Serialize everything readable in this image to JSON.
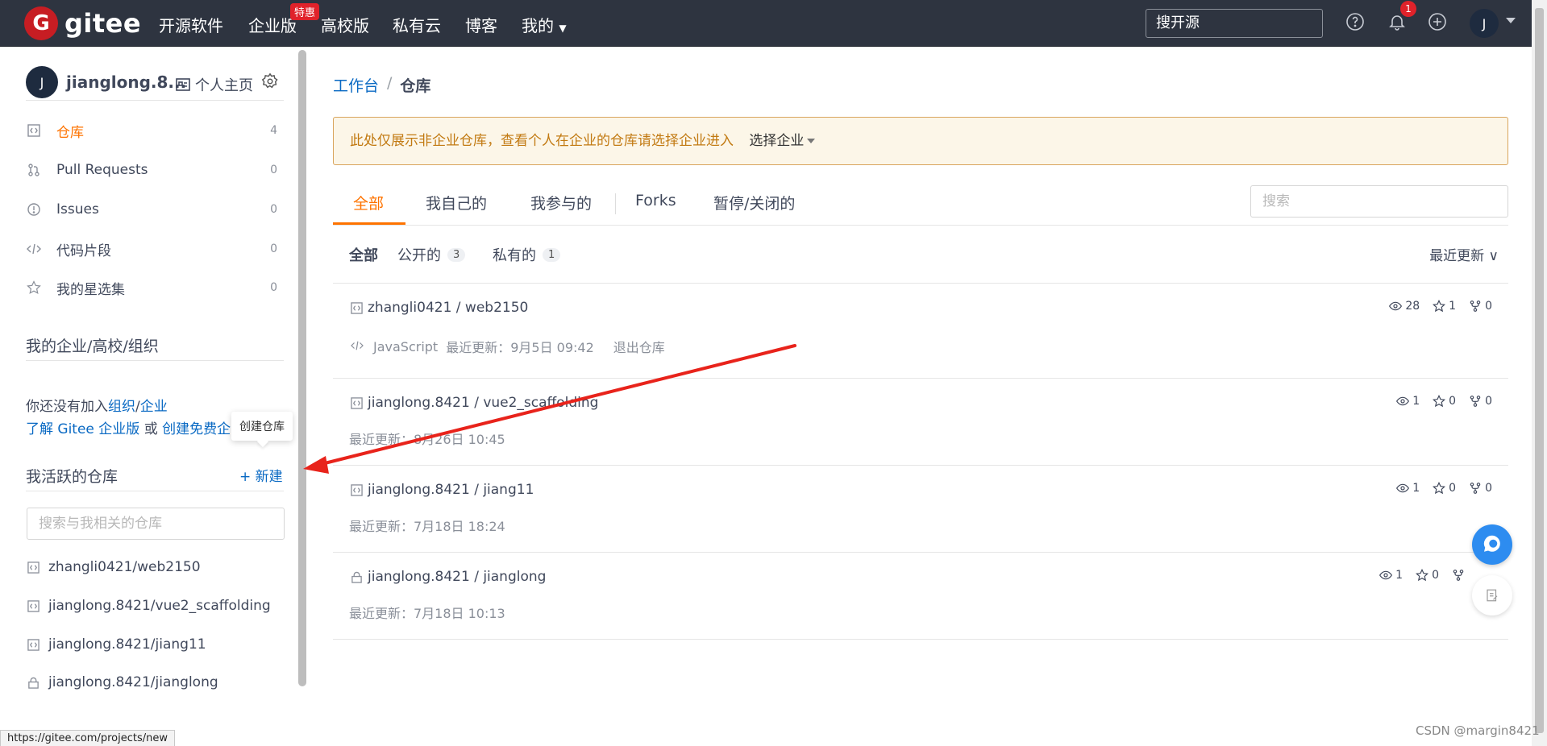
{
  "nav": {
    "logo_letter": "G",
    "logo_text": "gitee",
    "items": [
      "开源软件",
      "企业版",
      "高校版",
      "私有云",
      "博客",
      "我的"
    ],
    "promo_badge": "特惠",
    "search_placeholder": "搜开源",
    "notification_count": "1",
    "avatar_letter": "J"
  },
  "sidebar": {
    "avatar_letter": "J",
    "username": "jianglong.8...",
    "home_label": "个人主页",
    "menu": [
      {
        "label": "仓库",
        "count": "4"
      },
      {
        "label": "Pull Requests",
        "count": "0"
      },
      {
        "label": "Issues",
        "count": "0"
      },
      {
        "label": "代码片段",
        "count": "0"
      },
      {
        "label": "我的星选集",
        "count": "0"
      }
    ],
    "org_title": "我的企业/高校/组织",
    "org_line1_prefix": "你还没有加入",
    "org_line1_link1": "组织",
    "org_line1_slash": "/",
    "org_line1_link2": "企业",
    "org_line2_link1": "了解 Gitee 企业版",
    "org_line2_or": " 或 ",
    "org_line2_link2": "创建免费企",
    "tooltip": "创建仓库",
    "active_title": "我活跃的仓库",
    "new_label": "+ 新建",
    "search_placeholder": "搜索与我相关的仓库",
    "repos": [
      "zhangli0421/web2150",
      "jianglong.8421/vue2_scaffolding",
      "jianglong.8421/jiang11",
      "jianglong.8421/jianglong"
    ]
  },
  "main": {
    "breadcrumb": {
      "root": "工作台",
      "sep": "/",
      "current": "仓库"
    },
    "notice": "此处仅展示非企业仓库，查看个人在企业的仓库请选择企业进入",
    "notice_select": "选择企业",
    "tabs": [
      "全部",
      "我自己的",
      "我参与的",
      "Forks",
      "暂停/关闭的"
    ],
    "search_placeholder": "搜索",
    "filters": {
      "all": "全部",
      "public": "公开的",
      "public_count": "3",
      "private": "私有的",
      "private_count": "1"
    },
    "sort": "最近更新 ∨",
    "repos": [
      {
        "name": "zhangli0421 / web2150",
        "lang": "JavaScript",
        "updated": "最近更新：9月5日 09:42",
        "action": "退出仓库",
        "watch": "28",
        "star": "1",
        "fork": "0"
      },
      {
        "name": "jianglong.8421 / vue2_scaffolding",
        "lang": "",
        "updated": "最近更新：8月26日 10:45",
        "action": "",
        "watch": "1",
        "star": "0",
        "fork": "0"
      },
      {
        "name": "jianglong.8421 / jiang11",
        "lang": "",
        "updated": "最近更新：7月18日 18:24",
        "action": "",
        "watch": "1",
        "star": "0",
        "fork": "0"
      },
      {
        "name": "jianglong.8421 / jianglong",
        "lang": "",
        "updated": "最近更新：7月18日 10:13",
        "action": "",
        "watch": "1",
        "star": "0",
        "fork": ""
      }
    ]
  },
  "status_url": "https://gitee.com/projects/new",
  "watermark": "CSDN @margin8421",
  "colors": {
    "accent": "#fe7300",
    "nav_bg": "#2e3440",
    "link": "#0969c3",
    "annotation_arrow": "#e8231b"
  }
}
